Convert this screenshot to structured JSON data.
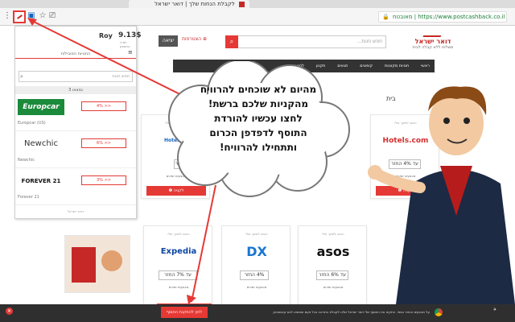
{
  "browser": {
    "tab_title": "לקבלת הנחות שלך | דואר ישראל",
    "url": "https://www.postcashback.co.il",
    "secure_label": "מאובטח"
  },
  "site": {
    "logo_name": "דואר ישראל",
    "logo_sub": "משלוח ללא קבלה לבית",
    "search_placeholder": "חפש חנות...",
    "join_label": "הצטרפות",
    "logout_label": "יציאה",
    "nav": [
      "ראשי",
      "חנויות מקוונות",
      "קופונים",
      "תנאים",
      "תקנון",
      "לחנות ◂"
    ],
    "section_label": "בית"
  },
  "popup": {
    "balance": "9.13$",
    "username": "Roy",
    "balance_sub": "יתרה בחשבון",
    "tab_label": "החנויות המובילות",
    "search_placeholder": "חפש חנות",
    "count_label": "נמצאו 3",
    "stores": [
      {
        "logo": "Europcar",
        "cash": "4% >>",
        "name": "Europcar (US)",
        "color": "#1b8a3a"
      },
      {
        "logo": "Newchic",
        "cash": "6% >>",
        "name": "Newchic",
        "color": "#333333"
      },
      {
        "logo": "FOREVER 21",
        "cash": "3% >>",
        "name": "Forever 21",
        "color": "#111111"
      }
    ],
    "footer": "דואר ישראל"
  },
  "cards": [
    {
      "label": "הטוב לתיווך שלי",
      "logo": "Hotels.com",
      "cash": "עד 4% החזר",
      "feature": "מבצעים זמינים",
      "button": "לקניה ❶",
      "color": "#d32f2f"
    },
    {
      "label": "הטוב לתיווך שלי",
      "logo": "Hotels Co",
      "cash": "3% החזר",
      "feature": "מבצעים זמינים",
      "button": "לקניה ❶",
      "color": "#1565c0"
    },
    {
      "label": "הטוב לתיווך שלי",
      "logo": "asos",
      "cash": "עד 6% החזר",
      "feature": "מבצעים זמינים",
      "button": "לקניה ❶",
      "color": "#111111"
    },
    {
      "label": "הטוב לתיווך שלי",
      "logo": "DX",
      "cash": "4% החזר",
      "feature": "מבצעים זמינים",
      "button": "לקניה ❶",
      "color": "#1976d2"
    },
    {
      "label": "הטוב לתיווך שלי",
      "logo": "Expedia",
      "cash": "עד 7% החזר",
      "feature": "מבצעים זמינים",
      "button": "לקניה ❶",
      "color": "#0d47a1"
    }
  ],
  "bubble": {
    "lines": [
      "מהיום לא שוכחים להרוויח",
      "מהקניות שלכם ברשת!",
      "לחצו עכשיו להורדת",
      "התוסף לדפדפן הכרום",
      "ותתחילו להרוויח!"
    ]
  },
  "notification": {
    "button_label": "לחץ להתקנת התוסף",
    "text": "על מבצעים והחזר כספי. התקינו את התוסף של דואר ישראל שלנו לקבלת התראה בכל פעם שנמצא לכם קאשבאק"
  },
  "colors": {
    "accent": "#e53935",
    "nav": "#333333"
  }
}
